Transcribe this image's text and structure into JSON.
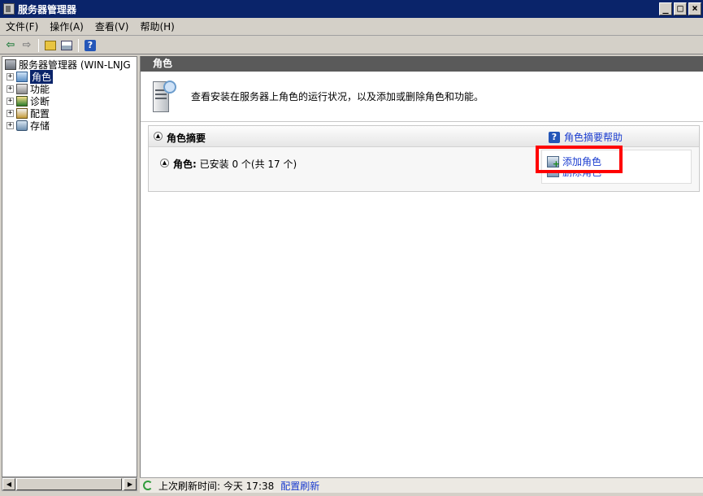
{
  "window": {
    "title": "服务器管理器",
    "controls": [
      "minimize",
      "maximize",
      "close"
    ]
  },
  "menubar": {
    "items": [
      "文件(F)",
      "操作(A)",
      "查看(V)",
      "帮助(H)"
    ]
  },
  "toolbar": {
    "icons": [
      "back-arrow-icon",
      "forward-arrow-icon",
      "up-level-icon",
      "show-hide-tree-icon",
      "help-icon"
    ]
  },
  "tree": {
    "root": "服务器管理器 (WIN-LNJG",
    "items": [
      {
        "label": "角色",
        "icon": "roles-icon",
        "selected": true
      },
      {
        "label": "功能",
        "icon": "features-icon",
        "selected": false
      },
      {
        "label": "诊断",
        "icon": "diagnostics-icon",
        "selected": false
      },
      {
        "label": "配置",
        "icon": "configuration-icon",
        "selected": false
      },
      {
        "label": "存储",
        "icon": "storage-icon",
        "selected": false
      }
    ]
  },
  "main": {
    "header": "角色",
    "intro_text": "查看安装在服务器上角色的运行状况，以及添加或删除角色和功能。",
    "summary": {
      "title": "角色摘要",
      "help_link": "角色摘要帮助",
      "roles_label": "角色:",
      "roles_status": "已安装 0 个(共 17 个)",
      "add_role": "添加角色",
      "remove_role": "删除角色"
    }
  },
  "status": {
    "last_refresh": "上次刷新时间: 今天 17:38",
    "configure_refresh": "配置刷新"
  },
  "colors": {
    "title_bar": "#0a246a",
    "pane_header": "#5a5a5a",
    "link": "#1a3ccf",
    "highlight": "#ff0000"
  }
}
